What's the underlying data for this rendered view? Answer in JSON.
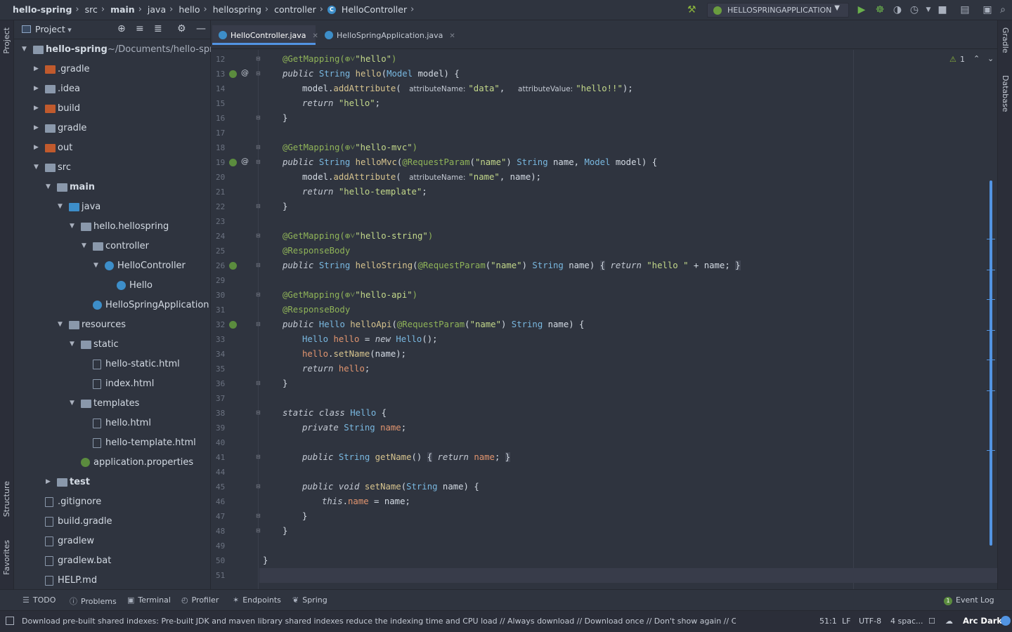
{
  "breadcrumbs": [
    "hello-spring",
    "src",
    "main",
    "java",
    "hello",
    "hellospring",
    "controller",
    "HelloController"
  ],
  "run_config": "HELLOSPRINGAPPLICATION",
  "left_strip": {
    "project": "Project",
    "structure": "Structure",
    "favorites": "Favorites"
  },
  "right_strip": {
    "gradle": "Gradle",
    "database": "Database"
  },
  "project_panel": {
    "title": "Project",
    "tree": [
      {
        "label": "hello-spring",
        "suffix": "~/Documents/hello-spring",
        "depth": 0,
        "expanded": true,
        "icon": "module",
        "bold": true
      },
      {
        "label": ".gradle",
        "depth": 1,
        "expanded": false,
        "icon": "folder-orange"
      },
      {
        "label": ".idea",
        "depth": 1,
        "expanded": false,
        "icon": "folder"
      },
      {
        "label": "build",
        "depth": 1,
        "expanded": false,
        "icon": "folder-orange"
      },
      {
        "label": "gradle",
        "depth": 1,
        "expanded": false,
        "icon": "folder"
      },
      {
        "label": "out",
        "depth": 1,
        "expanded": false,
        "icon": "folder-orange"
      },
      {
        "label": "src",
        "depth": 1,
        "expanded": true,
        "icon": "folder"
      },
      {
        "label": "main",
        "depth": 2,
        "expanded": true,
        "icon": "folder",
        "bold": true
      },
      {
        "label": "java",
        "depth": 3,
        "expanded": true,
        "icon": "folder-blue"
      },
      {
        "label": "hello.hellospring",
        "depth": 4,
        "expanded": true,
        "icon": "package"
      },
      {
        "label": "controller",
        "depth": 5,
        "expanded": true,
        "icon": "package"
      },
      {
        "label": "HelloController",
        "depth": 6,
        "expanded": true,
        "icon": "class"
      },
      {
        "label": "Hello",
        "depth": 7,
        "icon": "class"
      },
      {
        "label": "HelloSpringApplication",
        "depth": 5,
        "icon": "spring-class"
      },
      {
        "label": "resources",
        "depth": 3,
        "expanded": true,
        "icon": "folder"
      },
      {
        "label": "static",
        "depth": 4,
        "expanded": true,
        "icon": "folder"
      },
      {
        "label": "hello-static.html",
        "depth": 5,
        "icon": "html"
      },
      {
        "label": "index.html",
        "depth": 5,
        "icon": "html"
      },
      {
        "label": "templates",
        "depth": 4,
        "expanded": true,
        "icon": "folder"
      },
      {
        "label": "hello.html",
        "depth": 5,
        "icon": "html"
      },
      {
        "label": "hello-template.html",
        "depth": 5,
        "icon": "html"
      },
      {
        "label": "application.properties",
        "depth": 4,
        "icon": "spring-config"
      },
      {
        "label": "test",
        "depth": 2,
        "expanded": false,
        "icon": "folder",
        "bold": true
      },
      {
        "label": ".gitignore",
        "depth": 1,
        "icon": "file"
      },
      {
        "label": "build.gradle",
        "depth": 1,
        "icon": "gradle"
      },
      {
        "label": "gradlew",
        "depth": 1,
        "icon": "file"
      },
      {
        "label": "gradlew.bat",
        "depth": 1,
        "icon": "file"
      },
      {
        "label": "HELP.md",
        "depth": 1,
        "icon": "markdown"
      }
    ]
  },
  "editor_tabs": [
    {
      "label": "HelloController.java",
      "active": true
    },
    {
      "label": "HelloSpringApplication.java",
      "active": false
    }
  ],
  "warnings_count": "1",
  "code_lines": [
    {
      "n": "12",
      "tokens": [
        [
          "an",
          "@GetMapping("
        ],
        [
          "an",
          "⊕˅"
        ],
        [
          "st",
          "\"hello\""
        ],
        [
          "an",
          ")"
        ]
      ],
      "indent": 1
    },
    {
      "n": "13",
      "gutter": [
        "run",
        "at"
      ],
      "tokens": [
        [
          "kw",
          "public"
        ],
        [
          "pl",
          " "
        ],
        [
          "ty",
          "String"
        ],
        [
          "pl",
          " "
        ],
        [
          "fn",
          "hello"
        ],
        [
          "pl",
          "("
        ],
        [
          "ty",
          "Model"
        ],
        [
          "pl",
          " model) {"
        ]
      ],
      "indent": 1
    },
    {
      "n": "14",
      "tokens": [
        [
          "pl",
          "model."
        ],
        [
          "fn",
          "addAttribute"
        ],
        [
          "pl",
          "( "
        ],
        [
          "hint",
          "attributeName:"
        ],
        [
          "st",
          "\"data\""
        ],
        [
          "pl",
          ",  "
        ],
        [
          "hint",
          "attributeValue:"
        ],
        [
          "st",
          "\"hello!!\""
        ],
        [
          "pl",
          ");"
        ]
      ],
      "indent": 2
    },
    {
      "n": "15",
      "tokens": [
        [
          "kw",
          "return"
        ],
        [
          "pl",
          " "
        ],
        [
          "st",
          "\"hello\""
        ],
        [
          "pl",
          ";"
        ]
      ],
      "indent": 2
    },
    {
      "n": "16",
      "tokens": [
        [
          "pl",
          "}"
        ]
      ],
      "indent": 1
    },
    {
      "n": "17",
      "tokens": [],
      "indent": 0
    },
    {
      "n": "18",
      "tokens": [
        [
          "an",
          "@GetMapping("
        ],
        [
          "an",
          "⊕˅"
        ],
        [
          "st",
          "\"hello-mvc\""
        ],
        [
          "an",
          ")"
        ]
      ],
      "indent": 1
    },
    {
      "n": "19",
      "gutter": [
        "run",
        "at"
      ],
      "tokens": [
        [
          "kw",
          "public"
        ],
        [
          "pl",
          " "
        ],
        [
          "ty",
          "String"
        ],
        [
          "pl",
          " "
        ],
        [
          "fn",
          "helloMvc"
        ],
        [
          "pl",
          "("
        ],
        [
          "an",
          "@RequestParam"
        ],
        [
          "pl",
          "("
        ],
        [
          "st",
          "\"name\""
        ],
        [
          "pl",
          ") "
        ],
        [
          "ty",
          "String"
        ],
        [
          "pl",
          " name, "
        ],
        [
          "ty",
          "Model"
        ],
        [
          "pl",
          " model) {"
        ]
      ],
      "indent": 1
    },
    {
      "n": "20",
      "tokens": [
        [
          "pl",
          "model."
        ],
        [
          "fn",
          "addAttribute"
        ],
        [
          "pl",
          "( "
        ],
        [
          "hint",
          "attributeName:"
        ],
        [
          "st",
          "\"name\""
        ],
        [
          "pl",
          ", name);"
        ]
      ],
      "indent": 2
    },
    {
      "n": "21",
      "tokens": [
        [
          "kw",
          "return"
        ],
        [
          "pl",
          " "
        ],
        [
          "st",
          "\"hello-template\""
        ],
        [
          "pl",
          ";"
        ]
      ],
      "indent": 2
    },
    {
      "n": "22",
      "tokens": [
        [
          "pl",
          "}"
        ]
      ],
      "indent": 1
    },
    {
      "n": "23",
      "tokens": [],
      "indent": 0
    },
    {
      "n": "24",
      "tokens": [
        [
          "an",
          "@GetMapping("
        ],
        [
          "an",
          "⊕˅"
        ],
        [
          "st",
          "\"hello-string\""
        ],
        [
          "an",
          ")"
        ]
      ],
      "indent": 1
    },
    {
      "n": "25",
      "tokens": [
        [
          "an",
          "@ResponseBody"
        ]
      ],
      "indent": 1
    },
    {
      "n": "26",
      "gutter": [
        "run"
      ],
      "tokens": [
        [
          "kw",
          "public"
        ],
        [
          "pl",
          " "
        ],
        [
          "ty",
          "String"
        ],
        [
          "pl",
          " "
        ],
        [
          "fn",
          "helloString"
        ],
        [
          "pl",
          "("
        ],
        [
          "an",
          "@RequestParam"
        ],
        [
          "pl",
          "("
        ],
        [
          "st",
          "\"name\""
        ],
        [
          "pl",
          ") "
        ],
        [
          "ty",
          "String"
        ],
        [
          "pl",
          " name) "
        ],
        [
          "brk",
          "{"
        ],
        [
          "pl",
          " "
        ],
        [
          "kw",
          "return"
        ],
        [
          "pl",
          " "
        ],
        [
          "st",
          "\"hello \""
        ],
        [
          "pl",
          " + name; "
        ],
        [
          "brk",
          "}"
        ]
      ],
      "indent": 1
    },
    {
      "n": "29",
      "tokens": [],
      "indent": 0
    },
    {
      "n": "30",
      "tokens": [
        [
          "an",
          "@GetMapping("
        ],
        [
          "an",
          "⊕˅"
        ],
        [
          "st",
          "\"hello-api\""
        ],
        [
          "an",
          ")"
        ]
      ],
      "indent": 1
    },
    {
      "n": "31",
      "tokens": [
        [
          "an",
          "@ResponseBody"
        ]
      ],
      "indent": 1
    },
    {
      "n": "32",
      "gutter": [
        "run"
      ],
      "tokens": [
        [
          "kw",
          "public"
        ],
        [
          "pl",
          " "
        ],
        [
          "ty",
          "Hello"
        ],
        [
          "pl",
          " "
        ],
        [
          "fn",
          "helloApi"
        ],
        [
          "pl",
          "("
        ],
        [
          "an",
          "@RequestParam"
        ],
        [
          "pl",
          "("
        ],
        [
          "st",
          "\"name\""
        ],
        [
          "pl",
          ") "
        ],
        [
          "ty",
          "String"
        ],
        [
          "pl",
          " name) {"
        ]
      ],
      "indent": 1
    },
    {
      "n": "33",
      "tokens": [
        [
          "ty",
          "Hello"
        ],
        [
          "pl",
          " "
        ],
        [
          "vr",
          "hello"
        ],
        [
          "pl",
          " = "
        ],
        [
          "kw",
          "new"
        ],
        [
          "pl",
          " "
        ],
        [
          "ty",
          "Hello"
        ],
        [
          "pl",
          "();"
        ]
      ],
      "indent": 2
    },
    {
      "n": "34",
      "tokens": [
        [
          "vr",
          "hello"
        ],
        [
          "pl",
          "."
        ],
        [
          "fn",
          "setName"
        ],
        [
          "pl",
          "(name);"
        ]
      ],
      "indent": 2
    },
    {
      "n": "35",
      "tokens": [
        [
          "kw",
          "return"
        ],
        [
          "pl",
          " "
        ],
        [
          "vr",
          "hello"
        ],
        [
          "pl",
          ";"
        ]
      ],
      "indent": 2
    },
    {
      "n": "36",
      "tokens": [
        [
          "pl",
          "}"
        ]
      ],
      "indent": 1
    },
    {
      "n": "37",
      "tokens": [],
      "indent": 0
    },
    {
      "n": "38",
      "tokens": [
        [
          "kw",
          "static class"
        ],
        [
          "pl",
          " "
        ],
        [
          "ty",
          "Hello"
        ],
        [
          "pl",
          " {"
        ]
      ],
      "indent": 1
    },
    {
      "n": "39",
      "tokens": [
        [
          "kw",
          "private"
        ],
        [
          "pl",
          " "
        ],
        [
          "ty",
          "String"
        ],
        [
          "pl",
          " "
        ],
        [
          "vr",
          "name"
        ],
        [
          "pl",
          ";"
        ]
      ],
      "indent": 2
    },
    {
      "n": "40",
      "tokens": [],
      "indent": 0
    },
    {
      "n": "41",
      "tokens": [
        [
          "kw",
          "public"
        ],
        [
          "pl",
          " "
        ],
        [
          "ty",
          "String"
        ],
        [
          "pl",
          " "
        ],
        [
          "fn",
          "getName"
        ],
        [
          "pl",
          "() "
        ],
        [
          "brk",
          "{"
        ],
        [
          "pl",
          " "
        ],
        [
          "kw",
          "return"
        ],
        [
          "pl",
          " "
        ],
        [
          "vr",
          "name"
        ],
        [
          "pl",
          "; "
        ],
        [
          "brk",
          "}"
        ]
      ],
      "indent": 2
    },
    {
      "n": "44",
      "tokens": [],
      "indent": 0
    },
    {
      "n": "45",
      "tokens": [
        [
          "kw",
          "public"
        ],
        [
          "pl",
          " "
        ],
        [
          "kw",
          "void"
        ],
        [
          "pl",
          " "
        ],
        [
          "fn",
          "setName"
        ],
        [
          "pl",
          "("
        ],
        [
          "ty",
          "String"
        ],
        [
          "pl",
          " name) {"
        ]
      ],
      "indent": 2
    },
    {
      "n": "46",
      "tokens": [
        [
          "kw",
          "this"
        ],
        [
          "pl",
          "."
        ],
        [
          "vr",
          "name"
        ],
        [
          "pl",
          " = name;"
        ]
      ],
      "indent": 3
    },
    {
      "n": "47",
      "tokens": [
        [
          "pl",
          "}"
        ]
      ],
      "indent": 2
    },
    {
      "n": "48",
      "tokens": [
        [
          "pl",
          "}"
        ]
      ],
      "indent": 1
    },
    {
      "n": "49",
      "tokens": [],
      "indent": 0
    },
    {
      "n": "50",
      "tokens": [
        [
          "pl",
          "}"
        ]
      ],
      "indent": 0
    },
    {
      "n": "51",
      "tokens": [],
      "indent": 0,
      "current": true
    }
  ],
  "bottom_tools": [
    {
      "icon": "list-icon",
      "glyph": "☰",
      "label": "TODO"
    },
    {
      "icon": "problems-icon",
      "glyph": "ⓘ",
      "label": "Problems"
    },
    {
      "icon": "terminal-icon",
      "glyph": "▣",
      "label": "Terminal"
    },
    {
      "icon": "profiler-icon",
      "glyph": "◴",
      "label": "Profiler"
    },
    {
      "icon": "endpoints-icon",
      "glyph": "✶",
      "label": "Endpoints"
    },
    {
      "icon": "spring-icon",
      "glyph": "❦",
      "label": "Spring"
    }
  ],
  "event_log": {
    "count": "1",
    "label": "Event Log"
  },
  "status": {
    "message": "Download pre-built shared indexes: Pre-built JDK and maven library shared indexes reduce the indexing time and CPU load // Always download // Download once // Don't show again // Configur... (moments ag",
    "position": "51:1",
    "line_sep": "LF",
    "encoding": "UTF-8",
    "indent": "4 spac...",
    "theme": "Arc Dark"
  },
  "colors": {
    "accent": "#5294e2",
    "background": "#2f343f",
    "run_green": "#8ab43c",
    "spring_green": "#5b8c3e",
    "folder_orange": "#c05a2d",
    "class_blue": "#3d8ec9"
  }
}
